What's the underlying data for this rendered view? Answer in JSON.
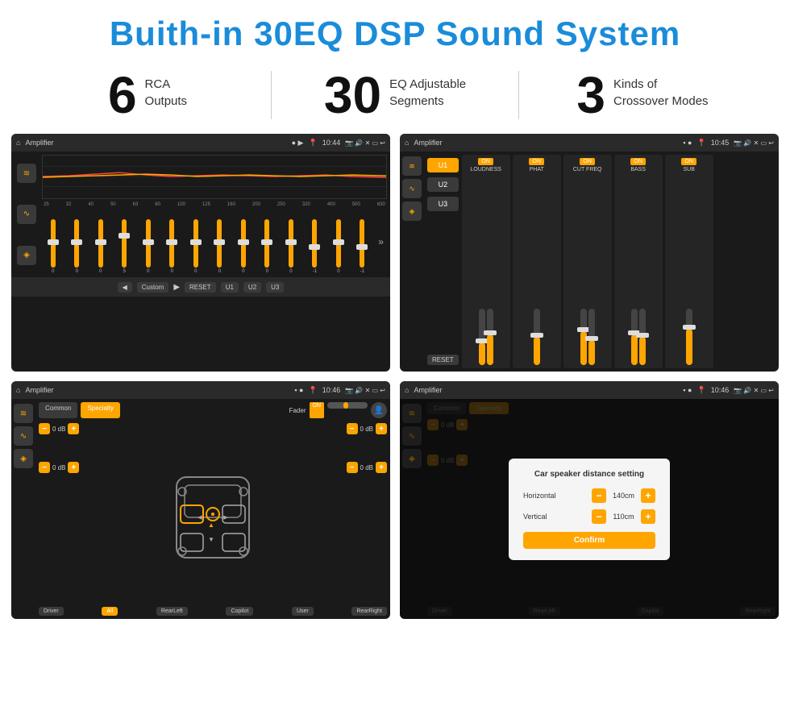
{
  "page": {
    "title": "Buith-in 30EQ DSP Sound System",
    "stats": [
      {
        "number": "6",
        "line1": "RCA",
        "line2": "Outputs"
      },
      {
        "number": "30",
        "line1": "EQ Adjustable",
        "line2": "Segments"
      },
      {
        "number": "3",
        "line1": "Kinds of",
        "line2": "Crossover Modes"
      }
    ]
  },
  "screen1": {
    "topbar": {
      "home": "⌂",
      "title": "Amplifier",
      "icons": "● ▶",
      "location": "📍",
      "time": "10:44",
      "controls": "📷 🔊 ✕ ▭ ↩"
    },
    "eq_labels": [
      "25",
      "32",
      "40",
      "50",
      "63",
      "80",
      "100",
      "125",
      "160",
      "200",
      "250",
      "320",
      "400",
      "500",
      "630"
    ],
    "eq_values": [
      "0",
      "0",
      "0",
      "5",
      "0",
      "0",
      "0",
      "0",
      "0",
      "0",
      "0",
      "-1",
      "0",
      "-1"
    ],
    "footer": {
      "prev": "◀",
      "label": "Custom",
      "next": "▶",
      "reset": "RESET",
      "u1": "U1",
      "u2": "U2",
      "u3": "U3"
    }
  },
  "screen2": {
    "topbar": {
      "home": "⌂",
      "title": "Amplifier",
      "time": "10:45"
    },
    "u_buttons": [
      "U1",
      "U2",
      "U3"
    ],
    "panels": [
      {
        "on": "ON",
        "label": "LOUDNESS"
      },
      {
        "on": "ON",
        "label": "PHAT"
      },
      {
        "on": "ON",
        "label": "CUT FREQ"
      },
      {
        "on": "ON",
        "label": "BASS"
      },
      {
        "on": "ON",
        "label": "SUB"
      }
    ],
    "reset": "RESET"
  },
  "screen3": {
    "topbar": {
      "home": "⌂",
      "title": "Amplifier",
      "time": "10:46"
    },
    "tabs": [
      "Common",
      "Specialty"
    ],
    "fader": {
      "label": "Fader",
      "on": "ON"
    },
    "db_values": [
      "0 dB",
      "0 dB",
      "0 dB",
      "0 dB"
    ],
    "footer_buttons": [
      "Driver",
      "All",
      "RearLeft",
      "Copilot",
      "User",
      "RearRight"
    ]
  },
  "screen4": {
    "topbar": {
      "home": "⌂",
      "title": "Amplifier",
      "time": "10:46"
    },
    "tabs": [
      "Common",
      "Specialty"
    ],
    "dialog": {
      "title": "Car speaker distance setting",
      "horizontal_label": "Horizontal",
      "horizontal_value": "140cm",
      "vertical_label": "Vertical",
      "vertical_value": "110cm",
      "confirm": "Confirm"
    },
    "db_right": [
      "0 dB",
      "0 dB"
    ],
    "footer_buttons": [
      "Driver",
      "RearLeft",
      "Copilot",
      "RearRight"
    ]
  },
  "icons": {
    "home": "⌂",
    "eq": "≋",
    "wave": "∿",
    "speaker": "◈",
    "minus": "−",
    "plus": "+",
    "chevron_left": "‹",
    "chevron_right": "›",
    "arrow_left": "◀",
    "arrow_right": "▶",
    "location": "📍",
    "camera": "📷",
    "volume": "🔊",
    "back": "↩"
  }
}
